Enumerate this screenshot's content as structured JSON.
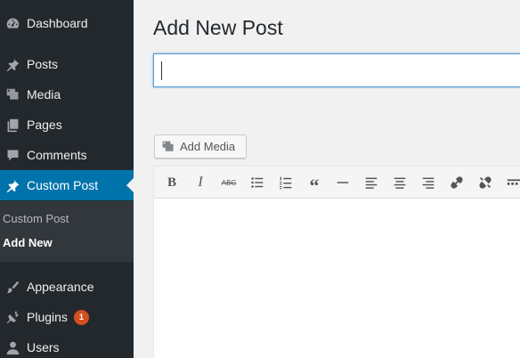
{
  "sidebar": {
    "items": [
      {
        "label": "Dashboard",
        "icon": "dashboard-icon"
      },
      {
        "label": "Posts",
        "icon": "pin-icon"
      },
      {
        "label": "Media",
        "icon": "media-icon"
      },
      {
        "label": "Pages",
        "icon": "pages-icon"
      },
      {
        "label": "Comments",
        "icon": "comment-icon"
      },
      {
        "label": "Custom Post",
        "icon": "pin-icon"
      },
      {
        "label": "Appearance",
        "icon": "brush-icon"
      },
      {
        "label": "Plugins",
        "icon": "plugin-icon",
        "badge": "1"
      },
      {
        "label": "Users",
        "icon": "user-icon"
      }
    ],
    "submenu": [
      {
        "label": "Custom Post"
      },
      {
        "label": "Add New"
      }
    ],
    "colors": {
      "background": "#23282d",
      "active": "#0073aa",
      "submenu": "#32373c",
      "badge": "#d54e21"
    }
  },
  "main": {
    "title": "Add New Post",
    "title_input": {
      "value": ""
    },
    "add_media_label": "Add Media",
    "toolbar": {
      "bold": "B",
      "italic": "I",
      "strikethrough": "ABC",
      "blockquote": "“",
      "icons": [
        "bold-icon",
        "italic-icon",
        "strikethrough-icon",
        "bullet-list-icon",
        "numbered-list-icon",
        "blockquote-icon",
        "horizontal-line-icon",
        "align-left-icon",
        "align-center-icon",
        "align-right-icon",
        "link-icon",
        "unlink-icon",
        "toolbar-toggle-icon"
      ]
    }
  }
}
